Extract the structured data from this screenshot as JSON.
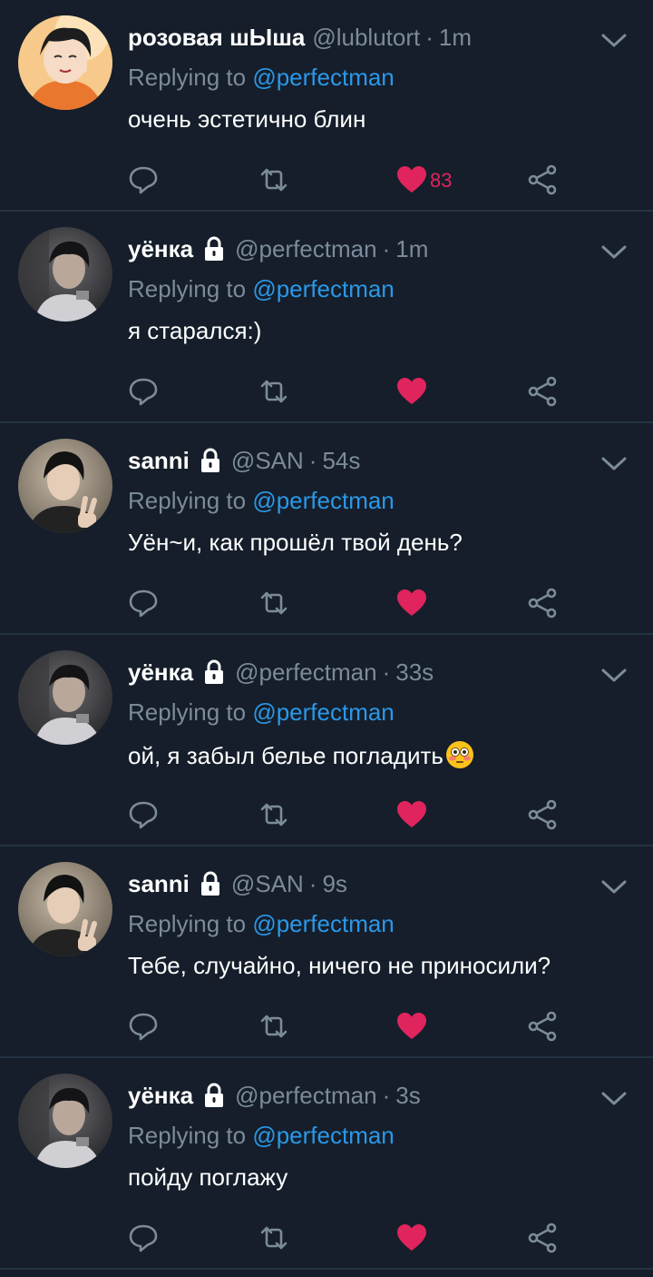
{
  "colors": {
    "background": "#151e2a",
    "divider": "#243343",
    "muted": "#7c8b9a",
    "link": "#2b98e8",
    "like": "#e0245e"
  },
  "tweets": [
    {
      "name": "розовая шЫша",
      "locked": false,
      "handle": "@lublutort",
      "dot": "·",
      "time": "1m",
      "replying_label": "Replying to",
      "replying_handle": "@perfectman",
      "text": "очень эстетично блин",
      "likes": "83",
      "avatar_icon": "anime-avatar"
    },
    {
      "name": "уёнка",
      "locked": true,
      "handle": "@perfectman",
      "dot": "·",
      "time": "1m",
      "replying_label": "Replying to",
      "replying_handle": "@perfectman",
      "text": "я старался:)",
      "likes": "",
      "avatar_icon": "photo-avatar-dark"
    },
    {
      "name": "sanni",
      "locked": true,
      "handle": "@SAN",
      "dot": "·",
      "time": "54s",
      "replying_label": "Replying to",
      "replying_handle": "@perfectman",
      "text": "Уён~и, как прошёл твой день?",
      "likes": "",
      "avatar_icon": "photo-avatar-peace"
    },
    {
      "name": "уёнка",
      "locked": true,
      "handle": "@perfectman",
      "dot": "·",
      "time": "33s",
      "replying_label": "Replying to",
      "replying_handle": "@perfectman",
      "text": "ой, я забыл белье погладить",
      "likes": "",
      "avatar_icon": "photo-avatar-dark",
      "emoji": "flushed-face-emoji"
    },
    {
      "name": "sanni",
      "locked": true,
      "handle": "@SAN",
      "dot": "·",
      "time": "9s",
      "replying_label": "Replying to",
      "replying_handle": "@perfectman",
      "text": "Тебе, случайно, ничего не приносили?",
      "likes": "",
      "avatar_icon": "photo-avatar-peace"
    },
    {
      "name": "уёнка",
      "locked": true,
      "handle": "@perfectman",
      "dot": "·",
      "time": "3s",
      "replying_label": "Replying to",
      "replying_handle": "@perfectman",
      "text": "пойду поглажу",
      "likes": "",
      "avatar_icon": "photo-avatar-dark"
    }
  ]
}
